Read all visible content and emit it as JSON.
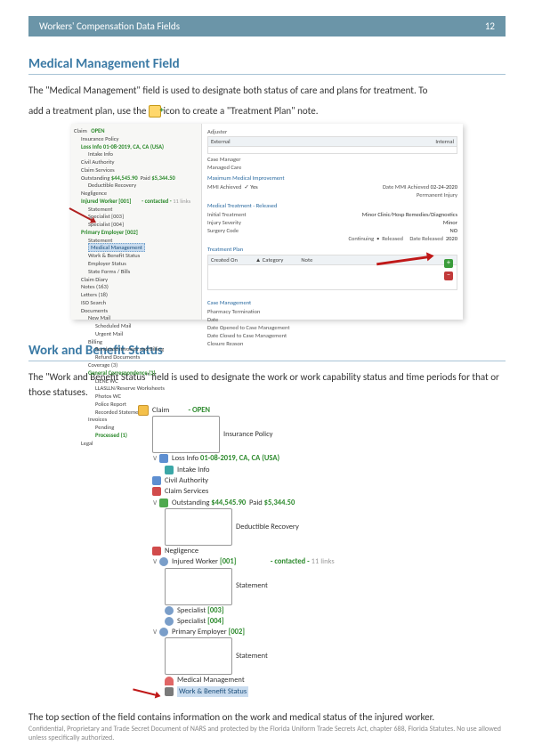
{
  "header": {
    "title": "Workers' Compensation Data Fields",
    "page": "12"
  },
  "section1": {
    "heading": "Medical Management Field",
    "para1_a": "The \"Medical ",
    "para1_b": "Management\" field is used to designate both status of care and plans for treatment.  To",
    "para2_a": "add a treatment plan, use the ",
    "para2_b": " icon to create a \"Treatment Plan\" note."
  },
  "shot1": {
    "tree": {
      "claim": "Claim",
      "status_open": "OPEN",
      "insurance_policy": "Insurance Policy",
      "loss_info": "Loss Info 01-08-2019, CA, CA (USA)",
      "intake_info": "Intake Info",
      "civil_authority": "Civil Authority",
      "claim_services": "Claim Services",
      "outstanding_label": "Outstanding",
      "outstanding_amt": "$44,545.90",
      "paid_label": "Paid",
      "paid_amt": "$5,344.50",
      "deductible_recovery": "Deductible Recovery",
      "negligence": "Negligence",
      "injured_worker": "Injured Worker [001]",
      "contacted": "- contacted -",
      "links": "11 links",
      "statement": "Statement",
      "specialist3": "Specialist [003]",
      "specialist4": "Specialist [004]",
      "primary_employer": "Primary Employer [002]",
      "medical_management": "Medical Management",
      "work_benefit_status": "Work & Benefit Status",
      "employer_status": "Employer Status",
      "state_forms_bills": "State Forms / Bills",
      "claim_diary": "Claim Diary",
      "notes": "Notes (163)",
      "letters": "Letters (18)",
      "iso_search": "ISO Search",
      "documents": "Documents",
      "new_mail": "New Mail",
      "scheduled_mail": "Scheduled Mail",
      "urgent_mail": "Urgent Mail",
      "billing": "Billing",
      "rendered_inv": "Rendered Invoices and Billing",
      "refund_docs": "Refund Documents",
      "coverage": "Coverage (3)",
      "general_corr": "General Correspondence (3)",
      "liene_wc": "LIENE WC",
      "llaslln": "LLASLLN/Reserve Worksheets",
      "photos_wc": "Photos WC",
      "police_report": "Police Report",
      "recorded_stmt": "Recorded Statements",
      "invoices": "Invoices",
      "pending": "Pending",
      "processed": "Processed (1)",
      "legal": "Legal"
    },
    "detail": {
      "adjuster_label": "Adjuster",
      "external": "External",
      "internal": "Internal",
      "case_manager": "Case Manager",
      "managed_care": "Managed Care",
      "mmi_heading": "Maximum Medical Improvement",
      "mmi_achieved_label": "MMI Achieved",
      "mmi_achieved_val": "✓ Yes",
      "date_mmi_label": "Date MMI Achieved",
      "date_mmi_val": "02-24-2020",
      "permanent_injury_label": "Permanent Injury",
      "mt_released_heading": "Medical Treatment - Released",
      "initial_treatment_label": "Initial Treatment",
      "initial_treatment_val": "Minor Clinic/Hosp Remedies/Diagnostics",
      "injury_severity_label": "Injury Severity",
      "injury_severity_val": "Minor",
      "surgery_code_label": "Surgery Code",
      "surgery_code_val": "NO",
      "continuing_label": "Continuing",
      "released_label": "Released",
      "date_released_label": "Date Released",
      "date_released_val": "2020",
      "treatment_plan_heading": "Treatment Plan",
      "tp_created_on": "Created On",
      "tp_category": "Category",
      "tp_note": "Note",
      "case_mgmt_heading": "Case Management",
      "pharmacy_term": "Pharmacy Termination",
      "date": "Date",
      "date_opened": "Date Opened to Case Management",
      "date_closed": "Date Closed to Case Management",
      "closure_reason": "Closure Reason"
    }
  },
  "section2": {
    "heading": "Work and Benefit Status",
    "para": "The \"Work and Benefit Status\" field is used to designate the work or work capability status and time periods for that or those statuses."
  },
  "shot2": {
    "claim": "Claim",
    "open": "- OPEN",
    "insurance_policy": "Insurance Policy",
    "loss_info": "Loss Info",
    "loss_info_green": "01-08-2019, CA, CA (USA)",
    "intake_info": "Intake Info",
    "civil_authority": "Civil Authority",
    "claim_services": "Claim Services",
    "outstanding_label": "Outstanding",
    "outstanding_amt": "$44,545.90",
    "paid_label": "Paid",
    "paid_amt": "$5,344.50",
    "deductible_recovery": "Deductible Recovery",
    "negligence": "Negligence",
    "injured_worker": "Injured Worker",
    "iw_code": "[001]",
    "contacted": "- contacted -",
    "links": "11 links",
    "statement": "Statement",
    "specialist3": "Specialist",
    "sp3_code": "[003]",
    "specialist4": "Specialist",
    "sp4_code": "[004]",
    "primary_employer": "Primary Employer",
    "pe_code": "[002]",
    "medical_management": "Medical Management",
    "work_benefit_status": "Work & Benefit Status"
  },
  "closing_text": "The top section of the field contains information on the work and medical status of the injured worker.",
  "footer": "Confidential, Proprietary and Trade Secret Document of NARS and protected by the Florida Uniform Trade Secrets Act, chapter 688, Florida Statutes. No use allowed unless specifically authorized."
}
